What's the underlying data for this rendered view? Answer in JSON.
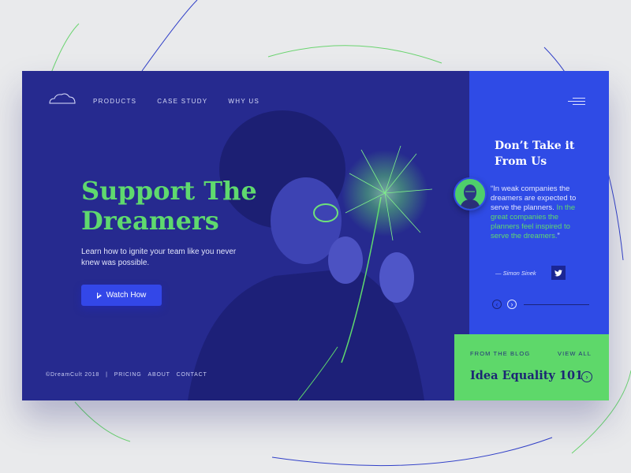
{
  "nav": {
    "logo_icon": "cloud-icon",
    "items": [
      "PRODUCTS",
      "CASE STUDY",
      "WHY US"
    ],
    "menu_icon": "hamburger-icon"
  },
  "hero": {
    "title": "Support The Dreamers",
    "subtitle": "Learn how to ignite your team like you never knew was possible.",
    "cta_label": "Watch How",
    "cta_icon": "play-icon"
  },
  "footer": {
    "copyright": "©DreamCult 2018",
    "separator": "|",
    "links": [
      "PRICING",
      "ABOUT",
      "CONTACT"
    ]
  },
  "testimonial": {
    "heading": "Don’t Take it From Us",
    "quote_part1": "“In weak companies the dreamers are expected to serve the planners.",
    "quote_part2": "In the great companies the planners feel inspired to serve the dreamers.",
    "quote_end": "”",
    "author": "— Simon Sinek",
    "twitter_icon": "twitter-icon",
    "prev_icon": "arrow-left-icon",
    "next_icon": "arrow-right-icon"
  },
  "blog": {
    "label": "FROM THE BLOG",
    "view_all": "VIEW ALL",
    "title": "Idea Equality 101",
    "arrow_icon": "arrow-right-icon"
  },
  "colors": {
    "hero_bg": "#262a8f",
    "accent_green": "#5fd96e",
    "side_blue": "#2f4be6",
    "button_blue": "#3347e8",
    "blog_green": "#5ed86a",
    "page_bg": "#e9eaec"
  }
}
